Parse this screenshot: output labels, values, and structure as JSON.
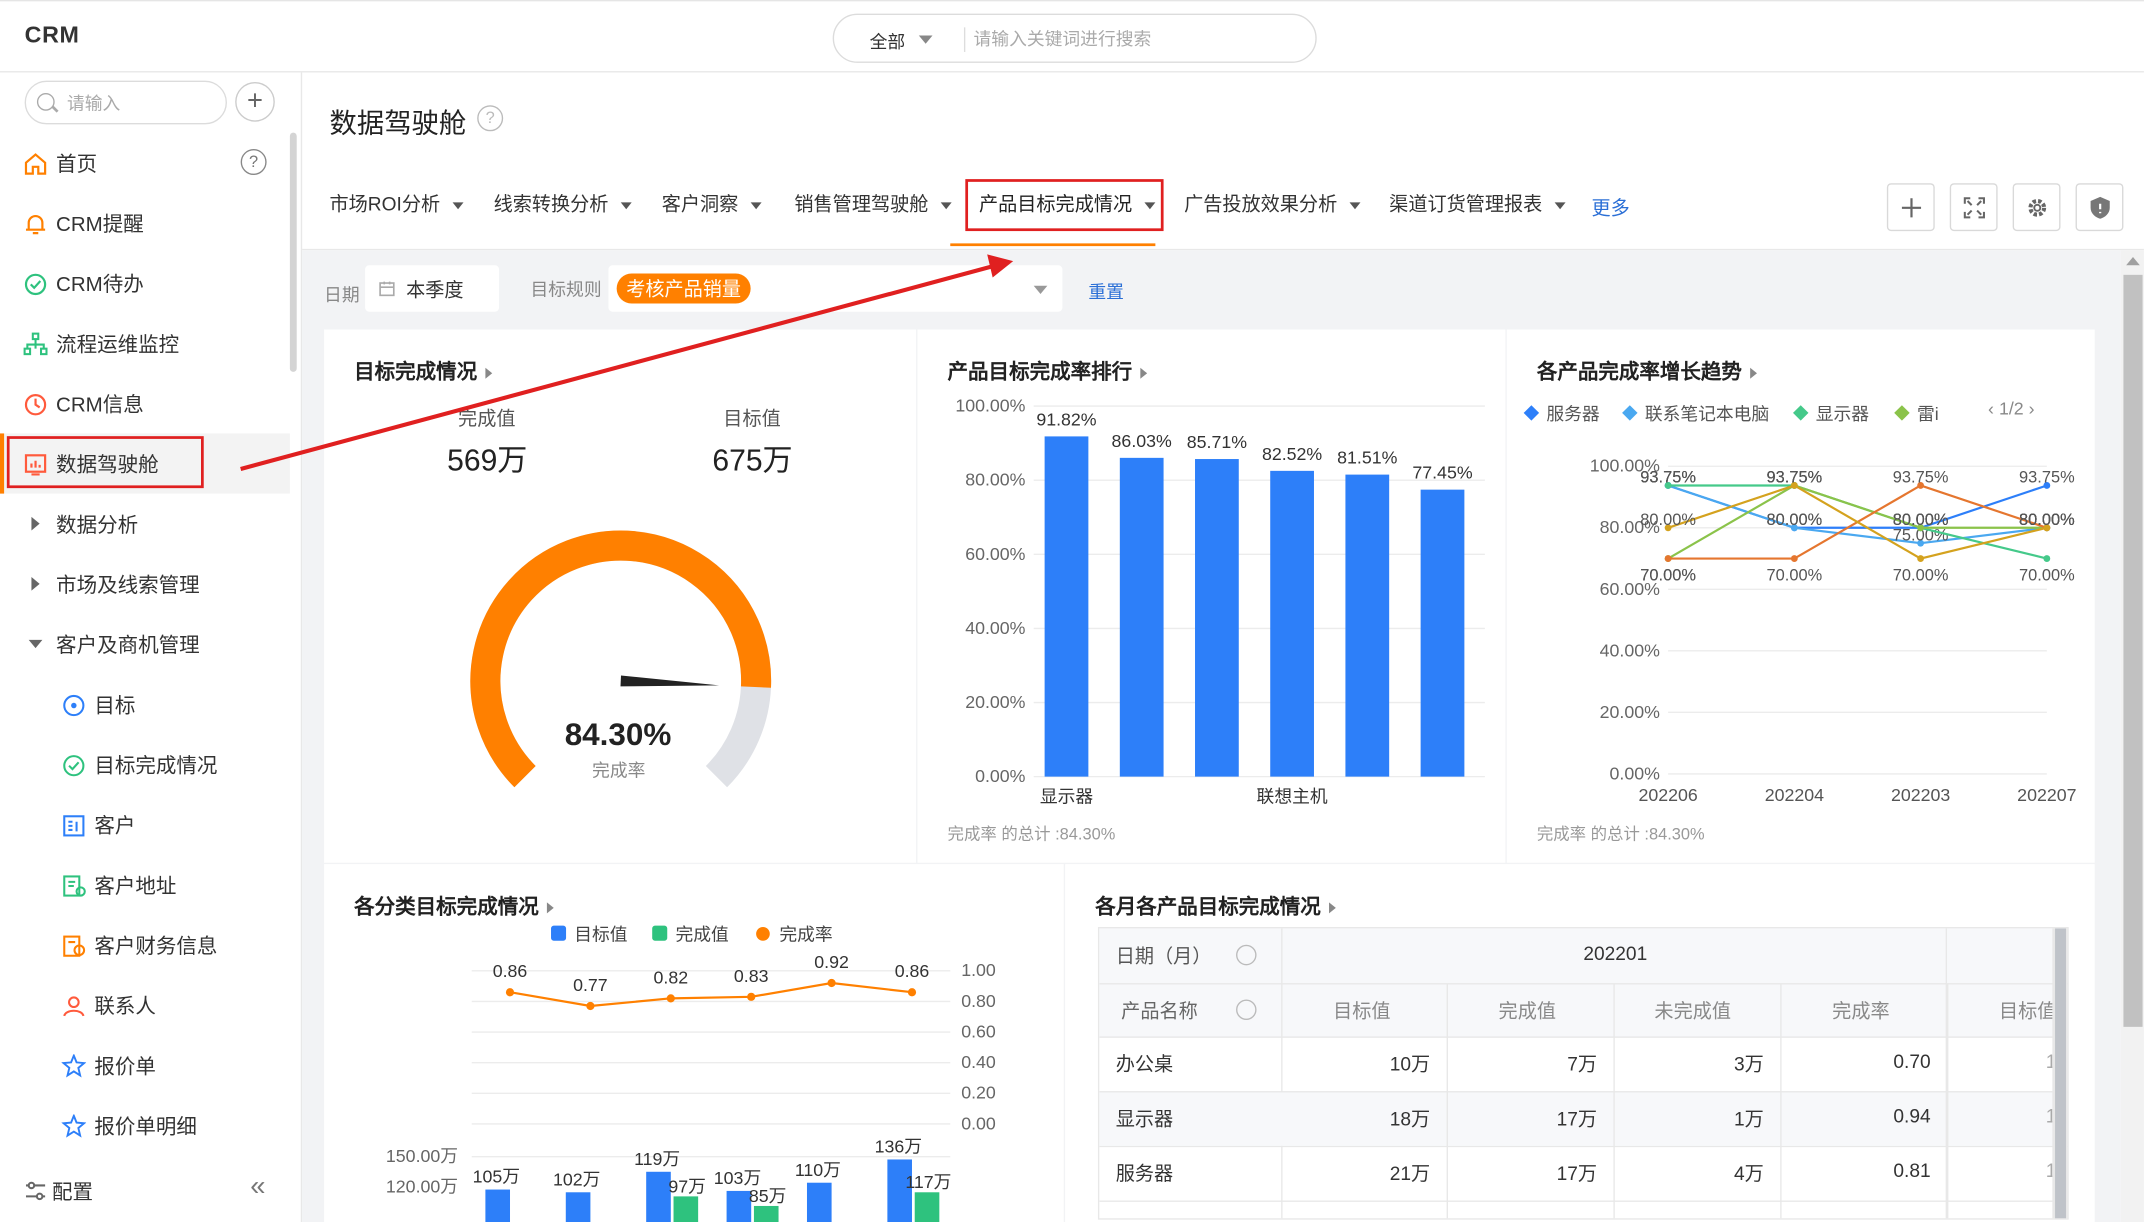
{
  "app": {
    "title": "CRM"
  },
  "search": {
    "scope": "全部",
    "placeholder": "请输入关键词进行搜索"
  },
  "sidebar": {
    "search_placeholder": "请输入",
    "items": [
      {
        "label": "首页",
        "icon": "home-icon"
      },
      {
        "label": "CRM提醒",
        "icon": "bell-icon"
      },
      {
        "label": "CRM待办",
        "icon": "check-circle-icon"
      },
      {
        "label": "流程运维监控",
        "icon": "flow-icon"
      },
      {
        "label": "CRM信息",
        "icon": "clock-icon"
      },
      {
        "label": "数据驾驶舱",
        "icon": "dashboard-icon"
      },
      {
        "label": "数据分析"
      },
      {
        "label": "市场及线索管理"
      },
      {
        "label": "客户及商机管理"
      },
      {
        "label": "目标",
        "icon": "target-icon"
      },
      {
        "label": "目标完成情况",
        "icon": "check-circle-icon"
      },
      {
        "label": "客户",
        "icon": "customer-icon"
      },
      {
        "label": "客户地址",
        "icon": "address-icon"
      },
      {
        "label": "客户财务信息",
        "icon": "finance-icon"
      },
      {
        "label": "联系人",
        "icon": "contact-icon"
      },
      {
        "label": "报价单",
        "icon": "quote-icon"
      },
      {
        "label": "报价单明细",
        "icon": "quote-detail-icon"
      }
    ],
    "footer_label": "配置",
    "collapse_glyph": "«"
  },
  "page": {
    "title": "数据驾驶舱",
    "help": "?"
  },
  "tabs": [
    {
      "label": "市场ROI分析"
    },
    {
      "label": "线索转换分析"
    },
    {
      "label": "客户洞察"
    },
    {
      "label": "销售管理驾驶舱"
    },
    {
      "label": "产品目标完成情况"
    },
    {
      "label": "广告投放效果分析"
    },
    {
      "label": "渠道订货管理报表"
    }
  ],
  "more_label": "更多",
  "filters": {
    "date_label": "日期",
    "date_value": "本季度",
    "rule_label": "目标规则",
    "rule_tag": "考核产品销量",
    "reset_label": "重置"
  },
  "colors": {
    "accent": "#ff8000",
    "blue": "#2d7ff9",
    "green": "#2ec27e",
    "red_annot": "#e02020"
  },
  "goal_card": {
    "title": "目标完成情况",
    "done_label": "完成值",
    "done_value": "569万",
    "target_label": "目标值",
    "target_value": "675万",
    "rate_value": "84.30%",
    "rate_label": "完成率",
    "rate": 0.843
  },
  "rank_card": {
    "title": "产品目标完成率排行",
    "footer": "完成率 的总计 :84.30%"
  },
  "trend_card": {
    "title": "各产品完成率增长趋势",
    "pager": "1/2",
    "footer": "完成率 的总计 :84.30%"
  },
  "category_card": {
    "title": "各分类目标完成情况"
  },
  "monthly_card": {
    "title": "各月各产品目标完成情况",
    "header_date": "日期（月）",
    "header_month": "202201",
    "header_product": "产品名称",
    "columns": [
      "目标值",
      "完成值",
      "未完成值",
      "完成率",
      "目标值"
    ],
    "rows": [
      {
        "name": "办公桌",
        "cells": [
          "10万",
          "7万",
          "3万",
          "0.70",
          "1"
        ]
      },
      {
        "name": "显示器",
        "cells": [
          "18万",
          "17万",
          "1万",
          "0.94",
          "1"
        ]
      },
      {
        "name": "服务器",
        "cells": [
          "21万",
          "17万",
          "4万",
          "0.81",
          "1"
        ]
      }
    ]
  },
  "chart_data": [
    {
      "type": "bar",
      "title": "产品目标完成率排行",
      "categories": [
        "显示器",
        "",
        "",
        "联想主机",
        "",
        ""
      ],
      "values": [
        91.82,
        86.03,
        85.71,
        82.52,
        81.51,
        77.45
      ],
      "data_labels": [
        "91.82%",
        "86.03%",
        "85.71%",
        "82.52%",
        "81.51%",
        "77.45%"
      ],
      "yticks": [
        "0.00%",
        "20.00%",
        "40.00%",
        "60.00%",
        "80.00%",
        "100.00%"
      ],
      "ylim": [
        0,
        100
      ],
      "color": "#2d7ff9"
    },
    {
      "type": "line",
      "title": "各产品完成率增长趋势",
      "x": [
        "202206",
        "202204",
        "202203",
        "202207"
      ],
      "yticks": [
        "0.00%",
        "20.00%",
        "40.00%",
        "60.00%",
        "80.00%",
        "100.00%"
      ],
      "ylim": [
        0,
        100
      ],
      "legend": [
        "服务器",
        "联系笔记本电脑",
        "显示器",
        "雷i"
      ],
      "legend_colors": [
        "#2d7ff9",
        "#4aa8f0",
        "#45c98a",
        "#8bc34a"
      ],
      "series": [
        {
          "name": "服务器",
          "color": "#2d7ff9",
          "values": [
            93.75,
            80.0,
            80.0,
            93.75
          ]
        },
        {
          "name": "联系笔记本电脑",
          "color": "#4aa8f0",
          "values": [
            93.75,
            80.0,
            75.0,
            80.0
          ]
        },
        {
          "name": "显示器",
          "color": "#45c98a",
          "values": [
            93.75,
            93.75,
            80.0,
            70.0
          ]
        },
        {
          "name": "雷i",
          "color": "#8bc34a",
          "values": [
            70.0,
            93.75,
            80.0,
            80.0
          ]
        },
        {
          "color": "#e5762f",
          "values": [
            70.0,
            70.0,
            93.75,
            80.0
          ]
        },
        {
          "color": "#d4a21e",
          "values": [
            80.0,
            93.75,
            70.0,
            80.0
          ]
        }
      ],
      "point_labels": [
        "93.75%",
        "80.00%",
        "70.00%",
        "75.00%"
      ]
    },
    {
      "type": "bar",
      "title": "各分类目标完成情况",
      "legend": [
        "目标值",
        "完成值",
        "完成率"
      ],
      "line_values": [
        0.86,
        0.77,
        0.82,
        0.83,
        0.92,
        0.86
      ],
      "line_labels": [
        "0.86",
        "0.77",
        "0.82",
        "0.83",
        "0.92",
        "0.86"
      ],
      "right_ticks": [
        "0.00",
        "0.20",
        "0.40",
        "0.60",
        "0.80",
        "1.00"
      ],
      "left_ticks": [
        "120.00万",
        "150.00万"
      ],
      "target_labels": [
        "105万",
        "102万",
        "119万",
        "103万",
        "110万",
        "136万"
      ],
      "done_labels": [
        "",
        "",
        "97万",
        "85万",
        "",
        "117万"
      ]
    }
  ]
}
